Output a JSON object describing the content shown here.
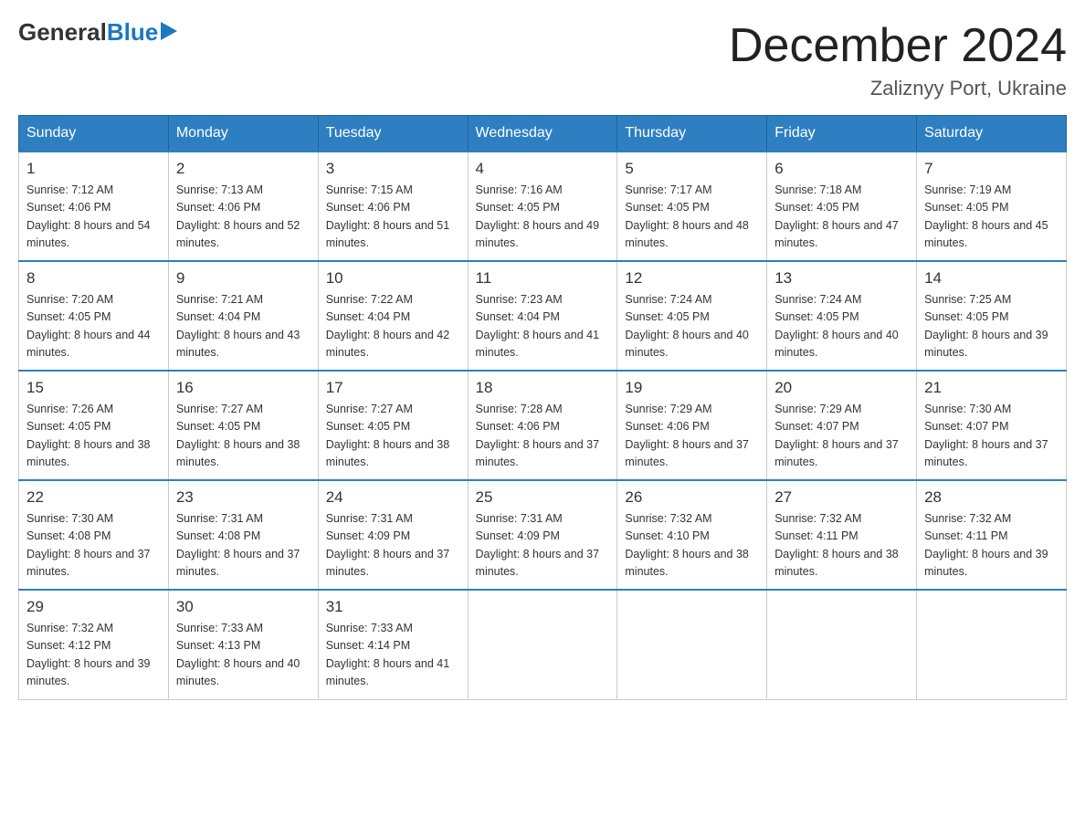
{
  "logo": {
    "general": "General",
    "blue": "Blue"
  },
  "title": "December 2024",
  "subtitle": "Zaliznyy Port, Ukraine",
  "days_header": [
    "Sunday",
    "Monday",
    "Tuesday",
    "Wednesday",
    "Thursday",
    "Friday",
    "Saturday"
  ],
  "weeks": [
    [
      {
        "day": "1",
        "sunrise": "7:12 AM",
        "sunset": "4:06 PM",
        "daylight": "8 hours and 54 minutes."
      },
      {
        "day": "2",
        "sunrise": "7:13 AM",
        "sunset": "4:06 PM",
        "daylight": "8 hours and 52 minutes."
      },
      {
        "day": "3",
        "sunrise": "7:15 AM",
        "sunset": "4:06 PM",
        "daylight": "8 hours and 51 minutes."
      },
      {
        "day": "4",
        "sunrise": "7:16 AM",
        "sunset": "4:05 PM",
        "daylight": "8 hours and 49 minutes."
      },
      {
        "day": "5",
        "sunrise": "7:17 AM",
        "sunset": "4:05 PM",
        "daylight": "8 hours and 48 minutes."
      },
      {
        "day": "6",
        "sunrise": "7:18 AM",
        "sunset": "4:05 PM",
        "daylight": "8 hours and 47 minutes."
      },
      {
        "day": "7",
        "sunrise": "7:19 AM",
        "sunset": "4:05 PM",
        "daylight": "8 hours and 45 minutes."
      }
    ],
    [
      {
        "day": "8",
        "sunrise": "7:20 AM",
        "sunset": "4:05 PM",
        "daylight": "8 hours and 44 minutes."
      },
      {
        "day": "9",
        "sunrise": "7:21 AM",
        "sunset": "4:04 PM",
        "daylight": "8 hours and 43 minutes."
      },
      {
        "day": "10",
        "sunrise": "7:22 AM",
        "sunset": "4:04 PM",
        "daylight": "8 hours and 42 minutes."
      },
      {
        "day": "11",
        "sunrise": "7:23 AM",
        "sunset": "4:04 PM",
        "daylight": "8 hours and 41 minutes."
      },
      {
        "day": "12",
        "sunrise": "7:24 AM",
        "sunset": "4:05 PM",
        "daylight": "8 hours and 40 minutes."
      },
      {
        "day": "13",
        "sunrise": "7:24 AM",
        "sunset": "4:05 PM",
        "daylight": "8 hours and 40 minutes."
      },
      {
        "day": "14",
        "sunrise": "7:25 AM",
        "sunset": "4:05 PM",
        "daylight": "8 hours and 39 minutes."
      }
    ],
    [
      {
        "day": "15",
        "sunrise": "7:26 AM",
        "sunset": "4:05 PM",
        "daylight": "8 hours and 38 minutes."
      },
      {
        "day": "16",
        "sunrise": "7:27 AM",
        "sunset": "4:05 PM",
        "daylight": "8 hours and 38 minutes."
      },
      {
        "day": "17",
        "sunrise": "7:27 AM",
        "sunset": "4:05 PM",
        "daylight": "8 hours and 38 minutes."
      },
      {
        "day": "18",
        "sunrise": "7:28 AM",
        "sunset": "4:06 PM",
        "daylight": "8 hours and 37 minutes."
      },
      {
        "day": "19",
        "sunrise": "7:29 AM",
        "sunset": "4:06 PM",
        "daylight": "8 hours and 37 minutes."
      },
      {
        "day": "20",
        "sunrise": "7:29 AM",
        "sunset": "4:07 PM",
        "daylight": "8 hours and 37 minutes."
      },
      {
        "day": "21",
        "sunrise": "7:30 AM",
        "sunset": "4:07 PM",
        "daylight": "8 hours and 37 minutes."
      }
    ],
    [
      {
        "day": "22",
        "sunrise": "7:30 AM",
        "sunset": "4:08 PM",
        "daylight": "8 hours and 37 minutes."
      },
      {
        "day": "23",
        "sunrise": "7:31 AM",
        "sunset": "4:08 PM",
        "daylight": "8 hours and 37 minutes."
      },
      {
        "day": "24",
        "sunrise": "7:31 AM",
        "sunset": "4:09 PM",
        "daylight": "8 hours and 37 minutes."
      },
      {
        "day": "25",
        "sunrise": "7:31 AM",
        "sunset": "4:09 PM",
        "daylight": "8 hours and 37 minutes."
      },
      {
        "day": "26",
        "sunrise": "7:32 AM",
        "sunset": "4:10 PM",
        "daylight": "8 hours and 38 minutes."
      },
      {
        "day": "27",
        "sunrise": "7:32 AM",
        "sunset": "4:11 PM",
        "daylight": "8 hours and 38 minutes."
      },
      {
        "day": "28",
        "sunrise": "7:32 AM",
        "sunset": "4:11 PM",
        "daylight": "8 hours and 39 minutes."
      }
    ],
    [
      {
        "day": "29",
        "sunrise": "7:32 AM",
        "sunset": "4:12 PM",
        "daylight": "8 hours and 39 minutes."
      },
      {
        "day": "30",
        "sunrise": "7:33 AM",
        "sunset": "4:13 PM",
        "daylight": "8 hours and 40 minutes."
      },
      {
        "day": "31",
        "sunrise": "7:33 AM",
        "sunset": "4:14 PM",
        "daylight": "8 hours and 41 minutes."
      },
      null,
      null,
      null,
      null
    ]
  ]
}
